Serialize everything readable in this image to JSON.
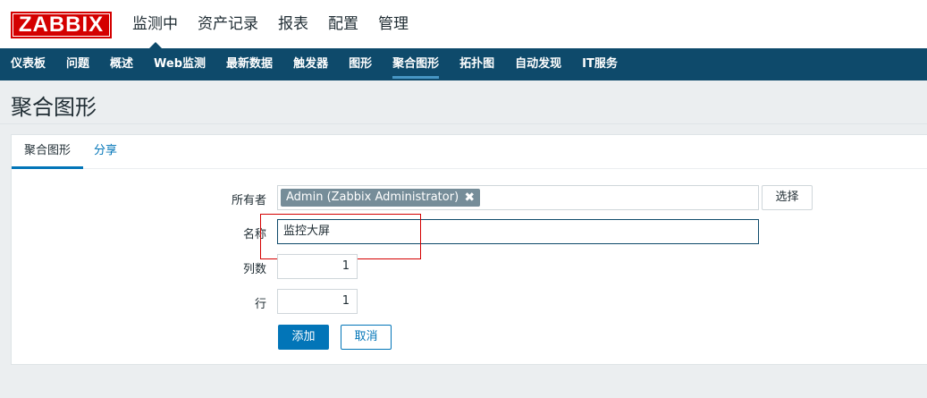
{
  "brand": {
    "logo": "ZABBIX"
  },
  "topnav": [
    {
      "label": "监测中"
    },
    {
      "label": "资产记录"
    },
    {
      "label": "报表"
    },
    {
      "label": "配置"
    },
    {
      "label": "管理"
    }
  ],
  "subnav": [
    {
      "label": "仪表板"
    },
    {
      "label": "问题"
    },
    {
      "label": "概述"
    },
    {
      "label": "Web监测"
    },
    {
      "label": "最新数据"
    },
    {
      "label": "触发器"
    },
    {
      "label": "图形"
    },
    {
      "label": "聚合图形"
    },
    {
      "label": "拓扑图"
    },
    {
      "label": "自动发现"
    },
    {
      "label": "IT服务"
    }
  ],
  "page": {
    "title": "聚合图形"
  },
  "tabs": {
    "tab1": "聚合图形",
    "tab2": "分享"
  },
  "form": {
    "owner_label": "所有者",
    "owner_value": "Admin (Zabbix Administrator)",
    "remove_glyph": "✖",
    "select_button": "选择",
    "name_label": "名称",
    "name_value": "监控大屏",
    "columns_label": "列数",
    "columns_value": "1",
    "rows_label": "行",
    "rows_value": "1",
    "add_button": "添加",
    "cancel_button": "取消"
  },
  "colors": {
    "brand_red": "#d40000",
    "nav_dark": "#0e4a6b",
    "accent_blue": "#0275b8"
  }
}
